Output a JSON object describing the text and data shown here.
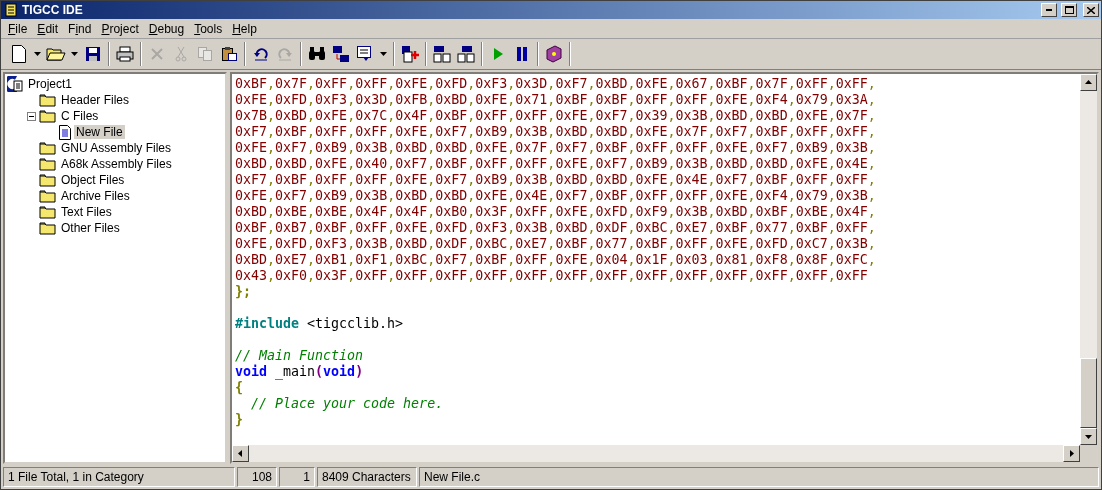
{
  "window": {
    "title": "TIGCC IDE"
  },
  "menu": [
    {
      "access_key": "F",
      "after": "ile"
    },
    {
      "access_key": "E",
      "after": "dit"
    },
    {
      "before": "F",
      "access_key": "i",
      "after": "nd"
    },
    {
      "access_key": "P",
      "after": "roject"
    },
    {
      "access_key": "D",
      "after": "ebug"
    },
    {
      "access_key": "T",
      "after": "ools"
    },
    {
      "access_key": "H",
      "after": "elp"
    }
  ],
  "toolbar": [
    [
      {
        "disabled": false,
        "dropdown": true
      },
      {
        "disabled": false,
        "dropdown": true
      },
      {
        "disabled": false,
        "dropdown": false
      }
    ],
    [
      {
        "disabled": false,
        "dropdown": false
      }
    ],
    [
      {
        "disabled": true,
        "dropdown": false
      },
      {
        "disabled": true,
        "dropdown": false
      },
      {
        "disabled": true,
        "dropdown": false
      },
      {
        "disabled": false,
        "dropdown": false
      }
    ],
    [
      {
        "disabled": false,
        "dropdown": false
      },
      {
        "disabled": true,
        "dropdown": false
      }
    ],
    [
      {
        "disabled": false,
        "dropdown": false
      },
      {
        "disabled": false,
        "dropdown": false
      },
      {
        "disabled": false,
        "dropdown": true
      }
    ],
    [
      {
        "disabled": false,
        "dropdown": false
      }
    ],
    [
      {
        "disabled": false,
        "dropdown": false
      },
      {
        "disabled": false,
        "dropdown": false
      }
    ],
    [
      {
        "disabled": false,
        "dropdown": false
      },
      {
        "disabled": false,
        "dropdown": false
      }
    ],
    [
      {
        "disabled": false,
        "dropdown": false
      }
    ]
  ],
  "tree": {
    "label": "Project1",
    "kind": "project",
    "children": [
      {
        "label": "Header Files",
        "kind": "folder",
        "selected": false
      },
      {
        "label": "C Files",
        "kind": "folder",
        "selected": false,
        "expanded": true,
        "children": [
          {
            "label": "New File",
            "kind": "file",
            "selected": true
          }
        ]
      },
      {
        "label": "GNU Assembly Files",
        "kind": "folder",
        "selected": false
      },
      {
        "label": "A68k Assembly Files",
        "kind": "folder",
        "selected": false
      },
      {
        "label": "Object Files",
        "kind": "folder",
        "selected": false
      },
      {
        "label": "Archive Files",
        "kind": "folder",
        "selected": false
      },
      {
        "label": "Text Files",
        "kind": "folder",
        "selected": false
      },
      {
        "label": "Other Files",
        "kind": "folder",
        "selected": false
      }
    ]
  },
  "editor": {
    "lines": [
      {
        "kind": "hex",
        "text": "0xBF,0x7F,0xFF,0xFF,0xFE,0xFD,0xF3,0x3D,0xF7,0xBD,0xFE,0x67,0xBF,0x7F,0xFF,0xFF,"
      },
      {
        "kind": "hex",
        "text": "0xFE,0xFD,0xF3,0x3D,0xFB,0xBD,0xFE,0x71,0xBF,0xBF,0xFF,0xFF,0xFE,0xF4,0x79,0x3A,"
      },
      {
        "kind": "hex",
        "text": "0x7B,0xBD,0xFE,0x7C,0x4F,0xBF,0xFF,0xFF,0xFE,0xF7,0x39,0x3B,0xBD,0xBD,0xFE,0x7F,"
      },
      {
        "kind": "hex",
        "text": "0xF7,0xBF,0xFF,0xFF,0xFE,0xF7,0xB9,0x3B,0xBD,0xBD,0xFE,0x7F,0xF7,0xBF,0xFF,0xFF,"
      },
      {
        "kind": "hex",
        "text": "0xFE,0xF7,0xB9,0x3B,0xBD,0xBD,0xFE,0x7F,0xF7,0xBF,0xFF,0xFF,0xFE,0xF7,0xB9,0x3B,"
      },
      {
        "kind": "hex",
        "text": "0xBD,0xBD,0xFE,0x40,0xF7,0xBF,0xFF,0xFF,0xFE,0xF7,0xB9,0x3B,0xBD,0xBD,0xFE,0x4E,"
      },
      {
        "kind": "hex",
        "text": "0xF7,0xBF,0xFF,0xFF,0xFE,0xF7,0xB9,0x3B,0xBD,0xBD,0xFE,0x4E,0xF7,0xBF,0xFF,0xFF,"
      },
      {
        "kind": "hex",
        "text": "0xFE,0xF7,0xB9,0x3B,0xBD,0xBD,0xFE,0x4E,0xF7,0xBF,0xFF,0xFF,0xFE,0xF4,0x79,0x3B,"
      },
      {
        "kind": "hex",
        "text": "0xBD,0xBE,0xBE,0x4F,0x4F,0xB0,0x3F,0xFF,0xFE,0xFD,0xF9,0x3B,0xBD,0xBF,0xBE,0x4F,"
      },
      {
        "kind": "hex",
        "text": "0xBF,0xB7,0xBF,0xFF,0xFE,0xFD,0xF3,0x3B,0xBD,0xDF,0xBC,0xE7,0xBF,0x77,0xBF,0xFF,"
      },
      {
        "kind": "hex",
        "text": "0xFE,0xFD,0xF3,0x3B,0xBD,0xDF,0xBC,0xE7,0xBF,0x77,0xBF,0xFF,0xFE,0xFD,0xC7,0x3B,"
      },
      {
        "kind": "hex",
        "text": "0xBD,0xE7,0xB1,0xF1,0xBC,0xF7,0xBF,0xFF,0xFE,0x04,0x1F,0x03,0x81,0xF8,0x8F,0xFC,"
      },
      {
        "kind": "hex",
        "text": "0x43,0xF0,0x3F,0xFF,0xFF,0xFF,0xFF,0xFF,0xFF,0xFF,0xFF,0xFF,0xFF,0xFF,0xFF,0xFF"
      },
      {
        "kind": "punct",
        "text": "};"
      },
      {
        "kind": "blank"
      },
      {
        "kind": "include",
        "directive": "#include",
        "header": "<tigcclib.h>"
      },
      {
        "kind": "blank"
      },
      {
        "kind": "comment",
        "text": "// Main Function"
      },
      {
        "kind": "signature",
        "type": "void",
        "name": "_main",
        "open_paren": "(",
        "params": "void",
        "close_paren": ")"
      },
      {
        "kind": "punct",
        "text": "{"
      },
      {
        "kind": "comment",
        "text": "  // Place your code here."
      },
      {
        "kind": "punct",
        "text": "}"
      }
    ]
  },
  "status_bar": {
    "summary": "1 File Total, 1 in Category",
    "line": "108",
    "column": "1",
    "characters": "8409 Characters",
    "file": "New File.c"
  }
}
